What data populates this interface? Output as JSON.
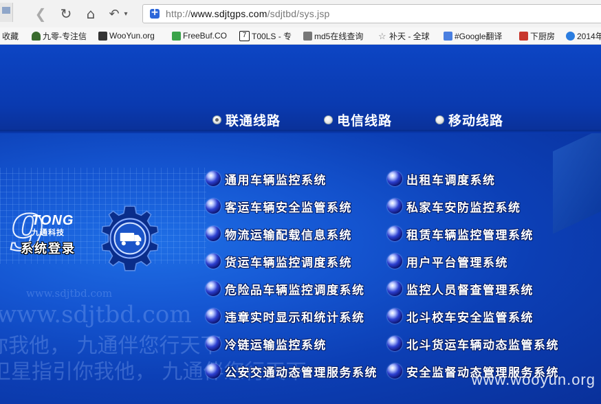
{
  "browser": {
    "url_prefix": "http://",
    "url_domain": "www.sdjtgps.com",
    "url_path": "/sdjtbd/sys.jsp",
    "bookmarks": [
      {
        "label": "收藏",
        "icon": "folder-icon",
        "color": ""
      },
      {
        "label": "九零-专注信",
        "icon": "wolf-icon",
        "color": "#3a6b2e"
      },
      {
        "label": "WooYun.org",
        "icon": "wooyun-icon",
        "color": "#333333"
      },
      {
        "label": "FreeBuf.CO",
        "icon": "freebuf-icon",
        "color": "#3aa34a"
      },
      {
        "label": "T00LS - 专",
        "icon": "tools-icon",
        "color": "#111111"
      },
      {
        "label": "md5在线查询",
        "icon": "md5-icon",
        "color": "#555555"
      },
      {
        "label": "补天 - 全球",
        "icon": "star-icon",
        "color": "#777777"
      },
      {
        "label": "#Google翻译",
        "icon": "google-translate-icon",
        "color": "#4a7fe0"
      },
      {
        "label": "下厨房",
        "icon": "xiachufang-icon",
        "color": "#c8372d"
      },
      {
        "label": "2014年",
        "icon": "play-icon",
        "color": "#2b7de0"
      }
    ]
  },
  "lines": [
    {
      "label": "联通线路",
      "checked": true
    },
    {
      "label": "电信线路",
      "checked": false
    },
    {
      "label": "移动线路",
      "checked": false
    }
  ],
  "logo": {
    "nine": "9",
    "tong": "TONG",
    "company": "九通科技",
    "login": "系统登录"
  },
  "systems_left": [
    "通用车辆监控系统",
    "客运车辆安全监管系统",
    "物流运输配载信息系统",
    "货运车辆监控调度系统",
    "危险品车辆监控调度系统",
    "违章实时显示和统计系统",
    "冷链运输监控系统",
    "公安交通动态管理服务系统"
  ],
  "systems_right": [
    "出租车调度系统",
    "私家车安防监控系统",
    "租赁车辆监控管理系统",
    "用户平台管理系统",
    "监控人员督查管理系统",
    "北斗校车安全监管系统",
    "北斗货运车辆动态监管系统",
    "安全监督动态管理服务系统"
  ],
  "background_text": {
    "site_small": "www.sdjtbd.com",
    "site_large": "www.sdjtbd.com",
    "slogan1": "你我他， 九通伴您行天下",
    "slogan2": "卫星指引你我他， 九通伴您行天下"
  },
  "watermark": "www.wooyun.org",
  "colors": {
    "page_blue": "#0a3fb8",
    "highlight_blue": "#1f6fe6"
  }
}
